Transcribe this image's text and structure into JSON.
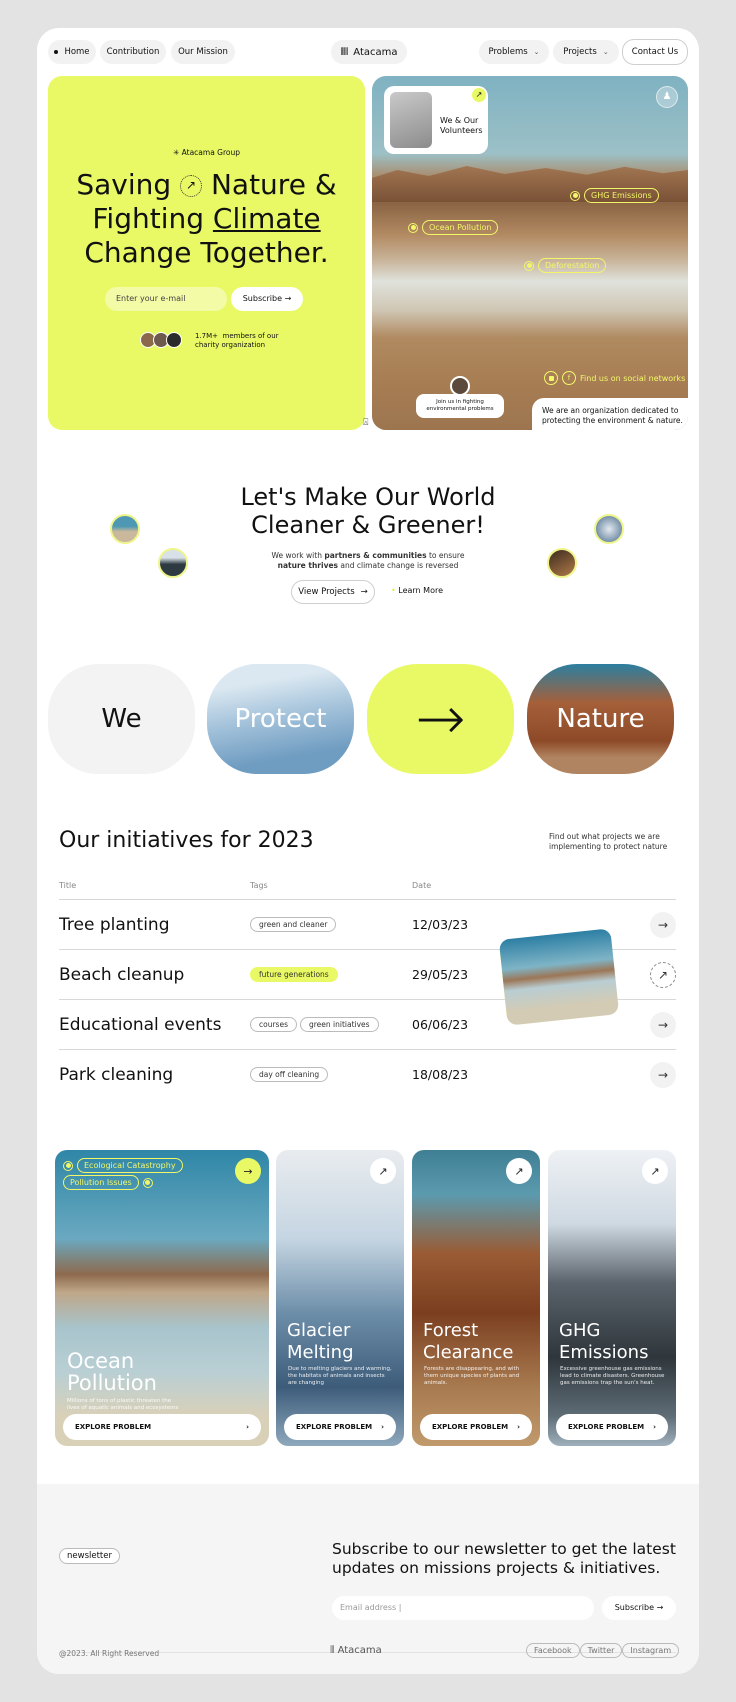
{
  "nav": {
    "left": [
      {
        "label": "Home"
      },
      {
        "label": "Contribution"
      },
      {
        "label": "Our Mission"
      }
    ],
    "brand": "Atacama",
    "right": [
      {
        "label": "Problems"
      },
      {
        "label": "Projects"
      }
    ],
    "contact": "Contact Us"
  },
  "hero": {
    "group": "Atacama Group",
    "title_1": "Saving",
    "title_1b": "Nature &",
    "title_2a": "Fighting",
    "title_2b": "Climate",
    "title_3": "Change Together.",
    "email_placeholder": "Enter your e-mail",
    "subscribe": "Subscribe",
    "members_count": "1.7M+",
    "members_text_1": "members of our",
    "members_text_2": "charity organization",
    "volunteers_1": "We & Our",
    "volunteers_2": "Volunteers",
    "tags": [
      "GHG Emissions",
      "Ocean Pollution",
      "Deforestation"
    ],
    "social": "Find us on social networks",
    "join_1": "Join us in fighting",
    "join_2": "environmental problems",
    "about_1": "We are an organization dedicated to",
    "about_2": "protecting the environment & nature."
  },
  "mission": {
    "title_1": "Let's Make Our World",
    "title_2": "Cleaner & Greener!",
    "sub_1a": "We work with ",
    "sub_1b": "partners & communities",
    "sub_1c": " to ensure",
    "sub_2a": "nature thrives",
    "sub_2b": " and climate change is reversed",
    "view": "View Projects",
    "learn": "Learn More"
  },
  "banner": {
    "we": "We",
    "protect": "Protect",
    "nature": "Nature"
  },
  "initiatives": {
    "title": "Our initiatives for 2023",
    "aside_1": "Find out what projects we are",
    "aside_2": "implementing to protect nature",
    "cols": [
      "Title",
      "Tags",
      "Date"
    ],
    "rows": [
      {
        "title": "Tree planting",
        "tags": [
          "green and cleaner"
        ],
        "date": "12/03/23"
      },
      {
        "title": "Beach cleanup",
        "tags": [
          "future generations"
        ],
        "date": "29/05/23"
      },
      {
        "title": "Educational events",
        "tags": [
          "courses",
          "green initiatives"
        ],
        "date": "06/06/23"
      },
      {
        "title": "Park cleaning",
        "tags": [
          "day off cleaning"
        ],
        "date": "18/08/23"
      }
    ]
  },
  "problems": {
    "explore": "EXPLORE PROBLEM",
    "cat_1": "Ecological Catastrophy",
    "cat_2": "Pollution Issues",
    "cards": [
      {
        "t1": "Ocean",
        "t2": "Pollution",
        "d1": "Millions of tons of plastic threaten the",
        "d2": "lives of aquatic animals and ecosystems",
        "d3": ""
      },
      {
        "t1": "Glacier",
        "t2": "Melting",
        "d1": "Due to melting glaciers and warming,",
        "d2": "the habitats of animals and insects",
        "d3": "are changing"
      },
      {
        "t1": "Forest",
        "t2": "Clearance",
        "d1": "Forests are disappearing, and with",
        "d2": "them unique species of plants and",
        "d3": "animals."
      },
      {
        "t1": "GHG",
        "t2": "Emissions",
        "d1": "Excessive greenhouse gas emissions",
        "d2": "lead to climate disasters. Greenhouse",
        "d3": "gas emissions trap the sun's heat."
      }
    ]
  },
  "newsletter": {
    "badge": "newsletter",
    "title_1": "Subscribe to our newsletter to get the latest",
    "title_2": "updates on missions projects & initiatives.",
    "placeholder": "Email address |",
    "subscribe": "Subscribe"
  },
  "footer": {
    "copyright": "@2023. All Right Reserved",
    "brand": "Atacama",
    "social": [
      "Facebook",
      "Twitter",
      "Instagram"
    ]
  },
  "colors": {
    "accent": "#e9f966"
  }
}
